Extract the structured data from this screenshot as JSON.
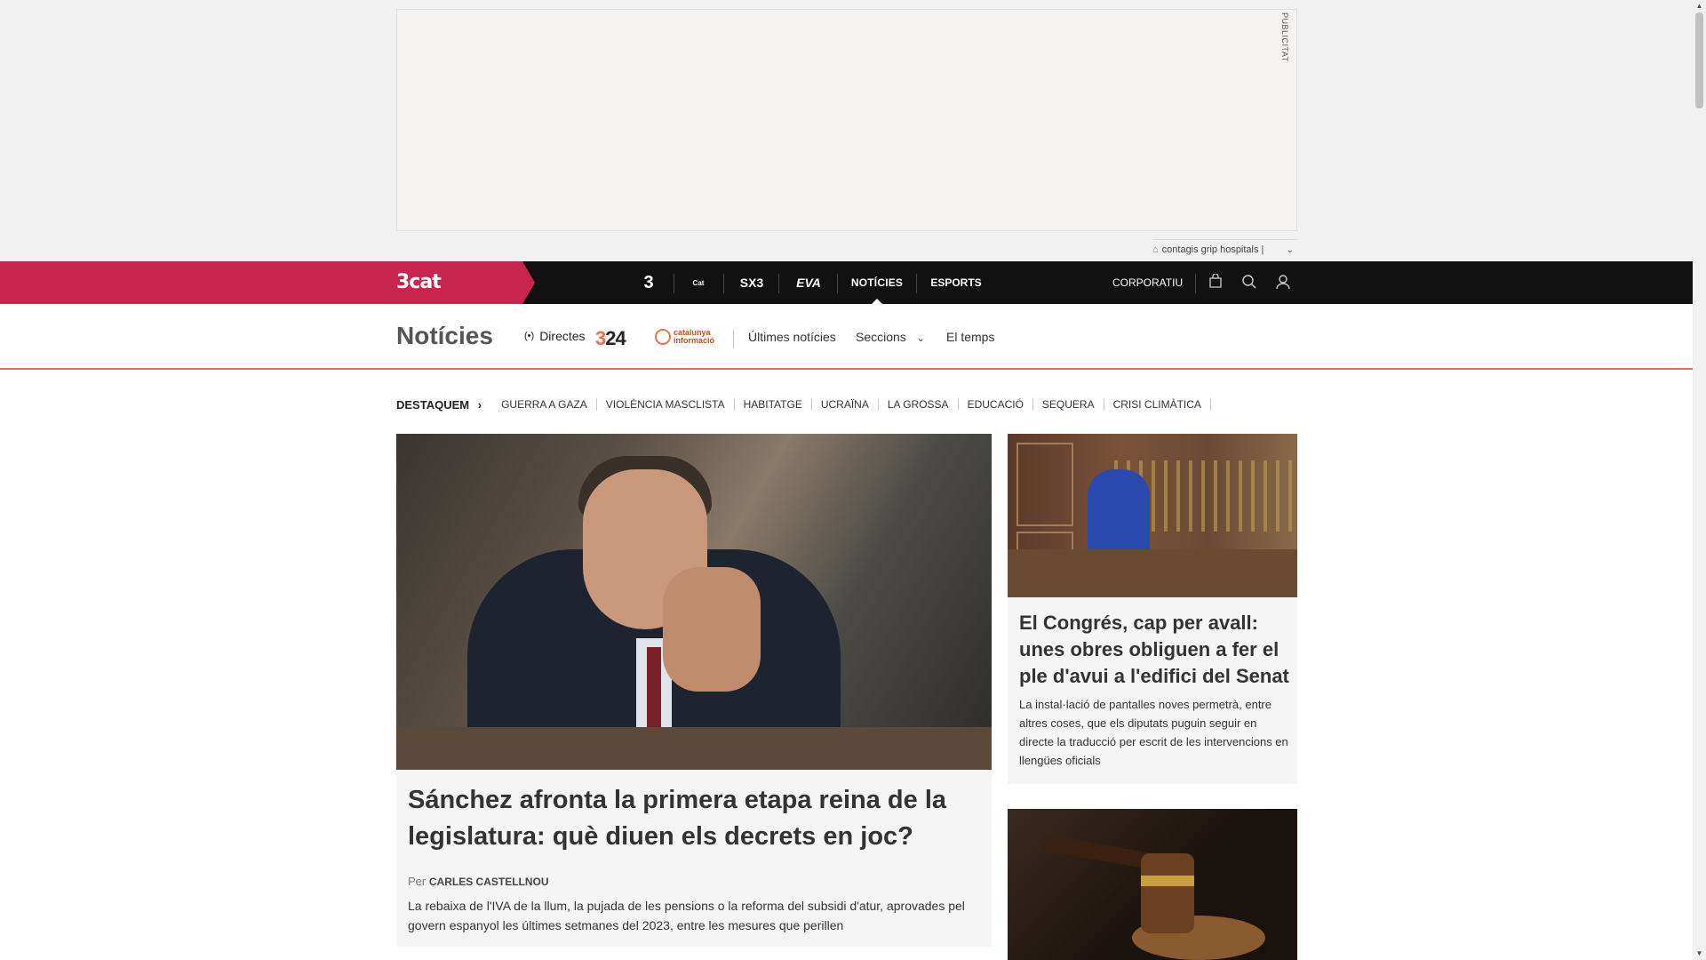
{
  "ad": {
    "label": "PUBLICITAT"
  },
  "trending": {
    "text": "contagis grip hospitals |"
  },
  "topbar": {
    "brand": "3cat",
    "channels": [
      "3",
      "Cat",
      "SX3",
      "EVA"
    ],
    "active_nav": "NOTÍCIES",
    "nav2": "ESPORTS",
    "corporate": "CORPORATIU"
  },
  "section": {
    "title": "Notícies",
    "live": "Directes",
    "logo324": {
      "three": "3",
      "rest": "24"
    },
    "logo_cat": "catalunya informació",
    "links": [
      "Últimes notícies",
      "Seccions",
      "El temps"
    ]
  },
  "topics": {
    "featured": "DESTAQUEM",
    "items": [
      "GUERRA A GAZA",
      "VIOLÈNCIA MASCLISTA",
      "HABITATGE",
      "UCRAÏNA",
      "LA GROSSA",
      "EDUCACIÓ",
      "SEQUERA",
      "CRISI CLIMÀTICA"
    ]
  },
  "main_article": {
    "title": "Sánchez afronta la primera etapa reina de la legislatura: què diuen els decrets en joc?",
    "by_prefix": "Per",
    "author": "CARLES CASTELLNOU",
    "summary": "La rebaixa de l'IVA de la llum, la pujada de les pensions o la reforma del subsidi d'atur, aprovades pel govern espanyol les últimes setmanes del 2023, entre les mesures que perillen"
  },
  "side_article": {
    "title": "El Congrés, cap per avall: unes obres obliguen a fer el ple d'avui a l'edifici del Senat",
    "summary": "La instal·lació de pantalles noves permetrà, entre altres coses, que els diputats puguin seguir en directe la traducció per escrit de les intervencions en llengües oficials"
  }
}
